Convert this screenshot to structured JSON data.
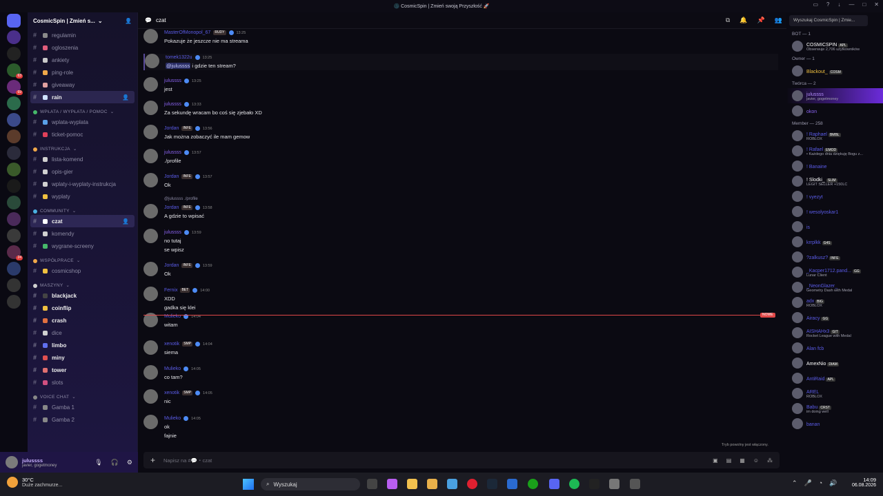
{
  "window": {
    "title": "🌑 CosmicSpin | Zmień swoją Przyszłość 🚀"
  },
  "guild": {
    "name": "CosmicSpin | Zmień s..."
  },
  "channels": [
    {
      "type": "ch",
      "label": "regulamin",
      "color": "#8a8a8a"
    },
    {
      "type": "ch",
      "label": "ogloszenia",
      "color": "#e05d7c"
    },
    {
      "type": "ch",
      "label": "ankiety",
      "color": "#c9c9c9"
    },
    {
      "type": "ch",
      "label": "ping-role",
      "color": "#f0a84a"
    },
    {
      "type": "ch",
      "label": "giveaway",
      "color": "#e0a0a0"
    },
    {
      "type": "ch",
      "label": "rain",
      "color": "#cfe3ff",
      "active": true,
      "bold": true
    },
    {
      "type": "cat",
      "label": "WPŁATA / WYPŁATA / POMOC",
      "color": "#46b86a"
    },
    {
      "type": "ch",
      "label": "wplata-wyplata",
      "color": "#5aa0e8"
    },
    {
      "type": "ch",
      "label": "ticket-pomoc",
      "color": "#e0405a"
    },
    {
      "type": "cat",
      "label": "INSTRUKCJA",
      "color": "#f0a84a"
    },
    {
      "type": "ch",
      "label": "lista-komend",
      "color": "#d0d0d0"
    },
    {
      "type": "ch",
      "label": "opis-gier",
      "color": "#d0d0d0"
    },
    {
      "type": "ch",
      "label": "wplaty-i-wyplaty-instrukcja",
      "color": "#d0d0d0"
    },
    {
      "type": "ch",
      "label": "wyplaty",
      "color": "#f0c040"
    },
    {
      "type": "cat",
      "label": "COMMUNITY",
      "color": "#4ab0e0"
    },
    {
      "type": "ch",
      "label": "czat",
      "color": "#ffffff",
      "active": true,
      "bold": true
    },
    {
      "type": "ch",
      "label": "komendy",
      "color": "#d0d0d0"
    },
    {
      "type": "ch",
      "label": "wygrane-screeny",
      "color": "#46b86a"
    },
    {
      "type": "cat",
      "label": "WSPÓŁPRACE",
      "color": "#f0a84a"
    },
    {
      "type": "ch",
      "label": "cosmicshop",
      "color": "#f0c040"
    },
    {
      "type": "cat",
      "label": "MASZYNY",
      "color": "#d0d0d0"
    },
    {
      "type": "ch",
      "label": "blackjack",
      "color": "#444",
      "bold": true
    },
    {
      "type": "ch",
      "label": "coinflip",
      "color": "#f0c040",
      "bold": true
    },
    {
      "type": "ch",
      "label": "crash",
      "color": "#e07040",
      "bold": true
    },
    {
      "type": "ch",
      "label": "dice",
      "color": "#d0d0d0"
    },
    {
      "type": "ch",
      "label": "limbo",
      "color": "#6070f0",
      "bold": true
    },
    {
      "type": "ch",
      "label": "miny",
      "color": "#e05050",
      "bold": true
    },
    {
      "type": "ch",
      "label": "tower",
      "color": "#e07070",
      "bold": true
    },
    {
      "type": "ch",
      "label": "slots",
      "color": "#d05080"
    },
    {
      "type": "cat",
      "label": "VOICE CHAT",
      "color": "#888"
    },
    {
      "type": "ch",
      "label": "Gamba 1",
      "color": "#888"
    },
    {
      "type": "ch",
      "label": "Gamba 2",
      "color": "#888"
    }
  ],
  "user": {
    "name": "julussss",
    "status": "javier, gogetmoney"
  },
  "channel_header": {
    "name": "czat"
  },
  "search": {
    "placeholder": "Wyszukaj CosmicSpin | Zmie..."
  },
  "messages": [
    {
      "author": "MasterOfMonopol_67",
      "tag": "RUDY",
      "time": "13:25",
      "lines": [
        "Pokazuje że jeszcze nie ma streama"
      ],
      "color": "#5b5ce8"
    },
    {
      "author": "tomek1322u",
      "tag": "",
      "time": "13:25",
      "lines": [
        "@julussss i gdzie ten stream?"
      ],
      "color": "#5b5ce8",
      "highlight": true
    },
    {
      "author": "julussss",
      "tag": "",
      "time": "13:25",
      "lines": [
        "jest"
      ],
      "color": "#8a63f0"
    },
    {
      "author": "julussss",
      "tag": "",
      "time": "13:33",
      "lines": [
        "Za sekundę wracam bo coś się zjebało XD"
      ],
      "color": "#8a63f0"
    },
    {
      "author": "Jordan",
      "tag": "INFE",
      "time": "13:56",
      "lines": [
        "Jak można zobaczyć ile mam gemow"
      ],
      "color": "#5b5ce8"
    },
    {
      "author": "julussss",
      "tag": "",
      "time": "13:57",
      "lines": [
        "./profile"
      ],
      "color": "#8a63f0"
    },
    {
      "author": "Jordan",
      "tag": "INFE",
      "time": "13:57",
      "lines": [
        "Ok"
      ],
      "color": "#5b5ce8"
    },
    {
      "author": "Jordan",
      "tag": "INFE",
      "time": "13:58",
      "lines": [
        "A gdzie to wpisać"
      ],
      "color": "#5b5ce8",
      "reply": "@julussss ./profile"
    },
    {
      "author": "julussss",
      "tag": "",
      "time": "13:59",
      "lines": [
        "no tutaj",
        "se wpisz"
      ],
      "color": "#8a63f0"
    },
    {
      "author": "Jordan",
      "tag": "INFE",
      "time": "13:59",
      "lines": [
        "Ok"
      ],
      "color": "#5b5ce8"
    },
    {
      "author": "Fernix",
      "tag": "BET",
      "time": "14:00",
      "lines": [
        "XDD",
        "gadka się klei"
      ],
      "color": "#5b5ce8"
    },
    {
      "author": "Mulieko",
      "tag": "",
      "time": "14:04",
      "lines": [
        "witam"
      ],
      "color": "#5b5ce8"
    },
    {
      "author": "xenotik",
      "tag": "SMP",
      "time": "14:04",
      "lines": [
        "siema"
      ],
      "color": "#5b5ce8"
    },
    {
      "author": "Mulieko",
      "tag": "",
      "time": "14:05",
      "lines": [
        "co tam?"
      ],
      "color": "#5b5ce8"
    },
    {
      "author": "xenotik",
      "tag": "SMP",
      "time": "14:05",
      "lines": [
        "nic"
      ],
      "color": "#5b5ce8"
    },
    {
      "author": "Mulieko",
      "tag": "",
      "time": "14:05",
      "lines": [
        "ok",
        "fajnie"
      ],
      "color": "#5b5ce8"
    }
  ],
  "new_label": "NOWE",
  "slowmode": "Tryb powolny jest włączony.",
  "composer": {
    "placeholder": "Napisz na #💬・czat"
  },
  "members": [
    {
      "type": "cat",
      "label": "BOT — 1"
    },
    {
      "type": "m",
      "name": "COSMICSPIN",
      "tag": "APL",
      "status": "Obserwuje 2,706 użytkowników",
      "color": "#ffffff"
    },
    {
      "type": "cat",
      "label": "Owner — 1"
    },
    {
      "type": "m",
      "name": "Blackout_",
      "tag": "COSM",
      "status": "",
      "color": "#f0c040"
    },
    {
      "type": "cat",
      "label": "Twórca — 2"
    },
    {
      "type": "m",
      "name": "julussss",
      "tag": "",
      "status": "javier, gogetmoney",
      "color": "#b48cff",
      "active": true
    },
    {
      "type": "m",
      "name": "okon",
      "tag": "",
      "status": "",
      "color": "#8a63f0"
    },
    {
      "type": "cat",
      "label": "Member — 258"
    },
    {
      "type": "m",
      "name": "! Raphael",
      "tag": "BMBL",
      "status": "ROBLOX",
      "color": "#5b5ce8"
    },
    {
      "type": "m",
      "name": "! Rafael",
      "tag": "EMOD",
      "status": "• Każdego dnia dziękuję Bogu z...",
      "color": "#5b5ce8"
    },
    {
      "type": "m",
      "name": "! Banaine",
      "tag": "",
      "status": "",
      "color": "#5b5ce8"
    },
    {
      "type": "m",
      "name": "! Slodki_",
      "tag": "SLIM",
      "status": "LEGIT SELLER +150LC",
      "color": "#ffffff"
    },
    {
      "type": "m",
      "name": "! vyezyt",
      "tag": "",
      "status": "",
      "color": "#5b5ce8"
    },
    {
      "type": "m",
      "name": "! wesolyoskar1",
      "tag": "",
      "status": "",
      "color": "#5b5ce8"
    },
    {
      "type": "m",
      "name": "is",
      "tag": "",
      "status": "",
      "color": "#5b5ce8"
    },
    {
      "type": "m",
      "name": "krrplkk",
      "tag": "G4S",
      "status": "",
      "color": "#5b5ce8"
    },
    {
      "type": "m",
      "name": "?zalkusz?",
      "tag": "INFE",
      "status": "",
      "color": "#5b5ce8"
    },
    {
      "type": "m",
      "name": "_Kacper1712.pand...",
      "tag": "GG",
      "status": "Lunar Client",
      "color": "#5b5ce8"
    },
    {
      "type": "m",
      "name": "_NeonGlazer_",
      "tag": "",
      "status": "Geometry Dash with Medal",
      "color": "#5b5ce8"
    },
    {
      "type": "m",
      "name": "adx",
      "tag": "BIG",
      "status": "ROBLOX",
      "color": "#5b5ce8"
    },
    {
      "type": "m",
      "name": "Airacy",
      "tag": "GG",
      "status": "",
      "color": "#5b5ce8"
    },
    {
      "type": "m",
      "name": "AISHAHx3",
      "tag": "GIT",
      "status": "Rocket League with Medal",
      "color": "#5b5ce8"
    },
    {
      "type": "m",
      "name": "Alan fcb",
      "tag": "",
      "status": "",
      "color": "#5b5ce8"
    },
    {
      "type": "m",
      "name": "AmexNio",
      "tag": "DIAM",
      "status": "",
      "color": "#ffffff"
    },
    {
      "type": "m",
      "name": "AntiRaid",
      "tag": "APL",
      "status": "",
      "color": "#5b5ce8"
    },
    {
      "type": "m",
      "name": "AREL",
      "tag": "",
      "status": "ROBLOX",
      "color": "#5b5ce8"
    },
    {
      "type": "m",
      "name": "Babu",
      "tag": "CRST",
      "status": "im doing well",
      "color": "#5b5ce8"
    },
    {
      "type": "m",
      "name": "banan",
      "tag": "",
      "status": "",
      "color": "#5b5ce8"
    }
  ],
  "taskbar": {
    "temp": "30°C",
    "weather": "Duże zachmurze...",
    "search": "Wyszukaj",
    "time": "14:09",
    "date": "06.08.2026"
  },
  "servers": [
    {
      "color": "#5865f2"
    },
    {
      "color": "#4a2f8a"
    },
    {
      "color": "#222"
    },
    {
      "color": "#2b5b2b",
      "badge": "63"
    },
    {
      "color": "#6a2b7a",
      "badge": "69"
    },
    {
      "color": "#2b6b4b"
    },
    {
      "color": "#3b4a8a"
    },
    {
      "color": "#5b3b2b"
    },
    {
      "color": "#2b2b3b"
    },
    {
      "color": "#3a5a2a"
    },
    {
      "color": "#1a1a1a"
    },
    {
      "color": "#2a4a3a"
    },
    {
      "color": "#4a2a5a"
    },
    {
      "color": "#3a3a3a"
    },
    {
      "color": "#5a2a4a",
      "badge": "24"
    },
    {
      "color": "#2a3a6a"
    },
    {
      "color": "#333"
    },
    {
      "color": "#333"
    }
  ]
}
